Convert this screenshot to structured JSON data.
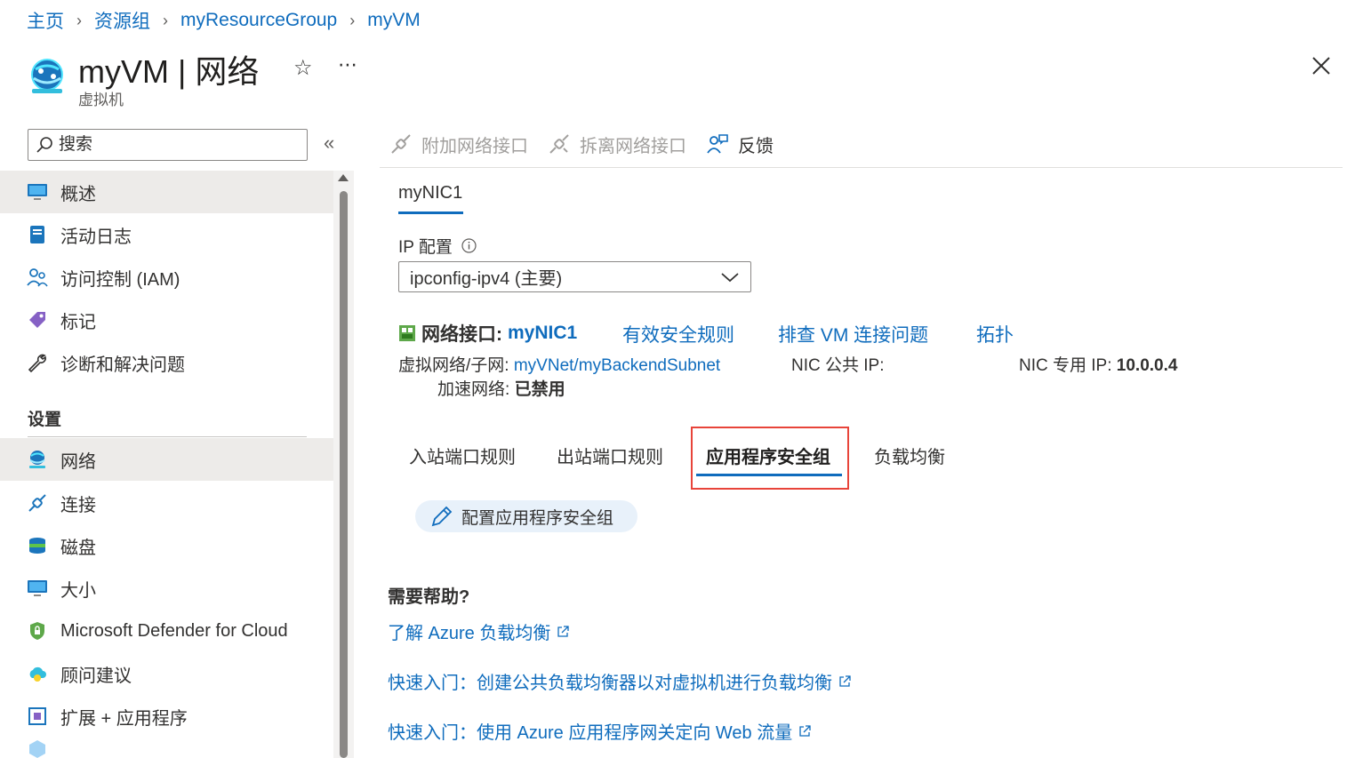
{
  "breadcrumb": [
    "主页",
    "资源组",
    "myResourceGroup",
    "myVM"
  ],
  "header": {
    "title": "myVM | 网络",
    "subtitle": "虚拟机"
  },
  "search": {
    "placeholder": "搜索"
  },
  "sidebar": {
    "items": [
      {
        "label": "概述",
        "icon": "monitor-icon"
      },
      {
        "label": "活动日志",
        "icon": "log-icon"
      },
      {
        "label": "访问控制 (IAM)",
        "icon": "people-icon"
      },
      {
        "label": "标记",
        "icon": "tag-icon"
      },
      {
        "label": "诊断和解决问题",
        "icon": "wrench-icon"
      }
    ],
    "section_settings": "设置",
    "settings_items": [
      {
        "label": "网络",
        "icon": "network-icon"
      },
      {
        "label": "连接",
        "icon": "plug-icon"
      },
      {
        "label": "磁盘",
        "icon": "disk-icon"
      },
      {
        "label": "大小",
        "icon": "monitor-icon"
      },
      {
        "label": "Microsoft Defender for Cloud",
        "icon": "shield-icon"
      },
      {
        "label": "顾问建议",
        "icon": "cloud-icon"
      },
      {
        "label": "扩展 + 应用程序",
        "icon": "extension-icon"
      }
    ]
  },
  "toolbar": {
    "attach": "附加网络接口",
    "detach": "拆离网络接口",
    "feedback": "反馈"
  },
  "nic_tab": "myNIC1",
  "ip_config": {
    "label": "IP 配置",
    "selected": "ipconfig-ipv4 (主要)"
  },
  "nic": {
    "label": "网络接口:",
    "name": "myNIC1",
    "effective_rules": "有效安全规则",
    "troubleshoot": "排查 VM 连接问题",
    "topology": "拓扑",
    "vnet_label": "虚拟网络/子网:",
    "vnet_value": "myVNet/myBackendSubnet",
    "public_ip_label": "NIC 公共 IP:",
    "private_ip_label": "NIC 专用 IP:",
    "private_ip_value": "10.0.0.4",
    "accel_label": "加速网络:",
    "accel_value": "已禁用"
  },
  "tabs": [
    "入站端口规则",
    "出站端口规则",
    "应用程序安全组",
    "负载均衡"
  ],
  "config_button": "配置应用程序安全组",
  "help": {
    "title": "需要帮助?",
    "links": [
      "了解 Azure 负载均衡",
      "快速入门：创建公共负载均衡器以对虚拟机进行负载均衡",
      "快速入门：使用 Azure 应用程序网关定向 Web 流量"
    ]
  },
  "colors": {
    "accent": "#0f6cbd",
    "highlight": "#e8443a",
    "active_bg": "#edebe9"
  }
}
